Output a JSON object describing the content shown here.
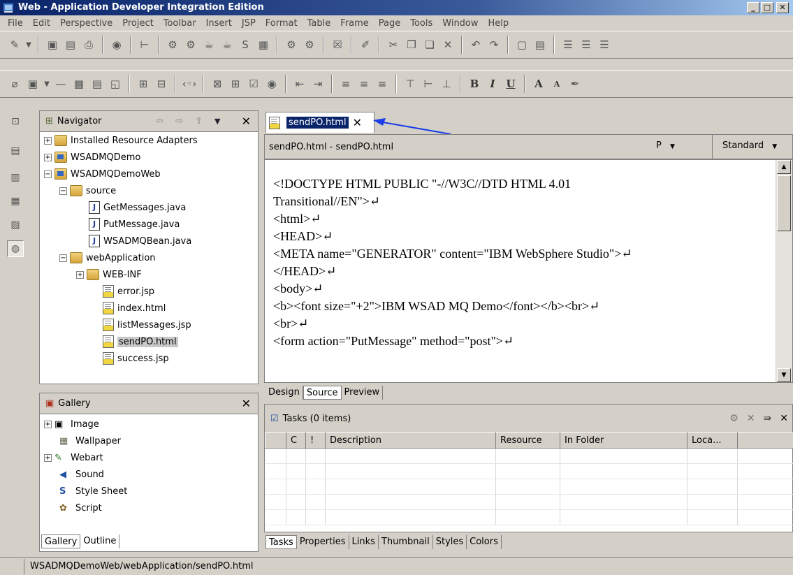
{
  "window": {
    "title": "Web - Application Developer Integration Edition",
    "controls": {
      "minimize": "_",
      "maximize": "□",
      "close": "✕"
    }
  },
  "menu": [
    "File",
    "Edit",
    "Perspective",
    "Project",
    "Toolbar",
    "Insert",
    "JSP",
    "Format",
    "Table",
    "Frame",
    "Page",
    "Tools",
    "Window",
    "Help"
  ],
  "toolbar2_text": {
    "bold": "B",
    "italic": "I",
    "underline": "U",
    "font_big": "A",
    "font_small": "A"
  },
  "navigator": {
    "title": "Navigator",
    "tree": [
      {
        "label": "Installed Resource Adapters",
        "depth": 0,
        "expander": "+",
        "icon": "folder"
      },
      {
        "label": "WSADMQDemo",
        "depth": 0,
        "expander": "+",
        "icon": "project"
      },
      {
        "label": "WSADMQDemoWeb",
        "depth": 0,
        "expander": "−",
        "icon": "project"
      },
      {
        "label": "source",
        "depth": 1,
        "expander": "−",
        "icon": "folder"
      },
      {
        "label": "GetMessages.java",
        "depth": 2,
        "expander": "",
        "icon": "java"
      },
      {
        "label": "PutMessage.java",
        "depth": 2,
        "expander": "",
        "icon": "java"
      },
      {
        "label": "WSADMQBean.java",
        "depth": 2,
        "expander": "",
        "icon": "java"
      },
      {
        "label": "webApplication",
        "depth": 1,
        "expander": "−",
        "icon": "folder"
      },
      {
        "label": "WEB-INF",
        "depth": 2,
        "expander": "+",
        "icon": "folder"
      },
      {
        "label": "error.jsp",
        "depth": 2,
        "expander": "",
        "icon": "page"
      },
      {
        "label": "index.html",
        "depth": 2,
        "expander": "",
        "icon": "page"
      },
      {
        "label": "listMessages.jsp",
        "depth": 2,
        "expander": "",
        "icon": "page"
      },
      {
        "label": "sendPO.html",
        "depth": 2,
        "expander": "",
        "icon": "page",
        "selected": true
      },
      {
        "label": "success.jsp",
        "depth": 2,
        "expander": "",
        "icon": "page"
      }
    ]
  },
  "gallery": {
    "title": "Gallery",
    "items": [
      {
        "label": "Image",
        "expander": "+"
      },
      {
        "label": "Wallpaper",
        "expander": ""
      },
      {
        "label": "Webart",
        "expander": "+"
      },
      {
        "label": "Sound",
        "expander": ""
      },
      {
        "label": "Style Sheet",
        "expander": ""
      },
      {
        "label": "Script",
        "expander": ""
      }
    ],
    "tabs": [
      "Gallery",
      "Outline"
    ]
  },
  "editor": {
    "tab_label": "sendPO.html",
    "path": "sendPO.html - sendPO.html",
    "encoding_select": "P",
    "view_select": "Standard",
    "code_lines": [
      "<!DOCTYPE HTML PUBLIC \"-//W3C//DTD HTML 4.01",
      "Transitional//EN\">↵",
      "<html>↵",
      "<HEAD>↵",
      "<META name=\"GENERATOR\" content=\"IBM WebSphere Studio\">↵",
      "</HEAD>↵",
      "<body>↵",
      "<b><font size=\"+2\">IBM WSAD MQ Demo</font></b><br>↵",
      "<br>↵",
      "<form action=\"PutMessage\" method=\"post\">↵"
    ],
    "mode_tabs": [
      "Design",
      "Source",
      "Preview"
    ]
  },
  "tasks": {
    "title": "Tasks (0 items)",
    "columns": [
      "",
      "C",
      "!",
      "Description",
      "Resource",
      "In Folder",
      "Loca..."
    ],
    "tabs": [
      "Tasks",
      "Properties",
      "Links",
      "Thumbnail",
      "Styles",
      "Colors"
    ]
  },
  "status": {
    "path": "WSADMQDemoWeb/webApplication/sendPO.html"
  },
  "colors": {
    "title_bar": "#0a246a",
    "selection": "#0a246a",
    "annotation_arrow": "#1a3ee8",
    "chrome": "#d4d0c8"
  }
}
